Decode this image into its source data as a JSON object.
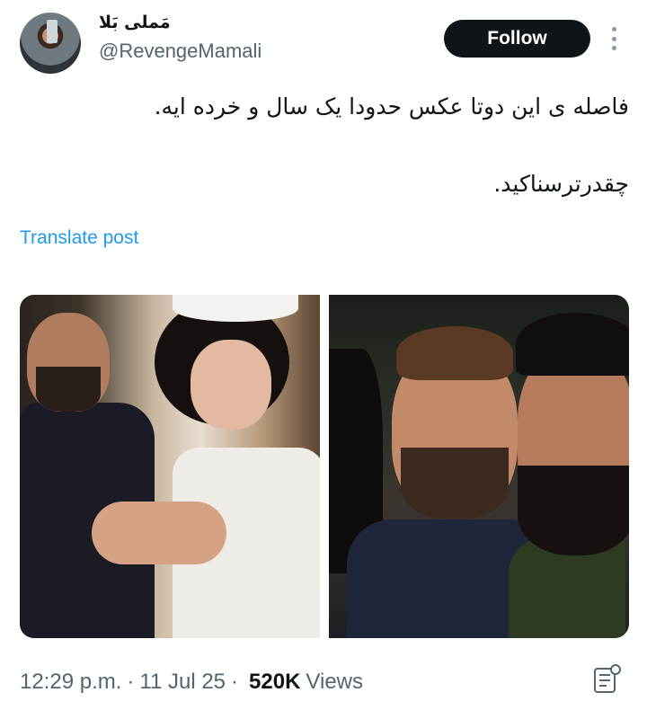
{
  "author": {
    "display_name": "مَملی بَلا",
    "handle": "@RevengeMamali",
    "avatar_icon": "profile-photo"
  },
  "actions": {
    "follow_label": "Follow",
    "more_icon": "more-vertical-icon"
  },
  "tweet": {
    "line1": "فاصله ی این دوتا عکس حدودا یک سال و خرده ایه.",
    "line2": "چقدرترسناکید.",
    "translate_label": "Translate post",
    "media": [
      {
        "description_icon": "wedding-photo"
      },
      {
        "description_icon": "selfie-photo"
      }
    ]
  },
  "meta": {
    "time": "12:29 p.m.",
    "date": "11 Jul 25",
    "views_count": "520K",
    "views_label": "Views",
    "separator": "·",
    "grok_icon": "grok-summary-icon"
  },
  "colors": {
    "link": "#1d9bf0",
    "secondary_text": "#536471",
    "primary_text": "#0f1419",
    "button_bg": "#0f1419"
  }
}
